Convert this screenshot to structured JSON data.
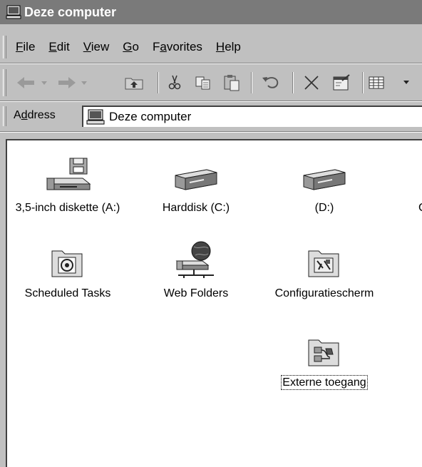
{
  "window": {
    "title": "Deze computer"
  },
  "menu": [
    {
      "pre": "",
      "key": "F",
      "post": "ile"
    },
    {
      "pre": "",
      "key": "E",
      "post": "dit"
    },
    {
      "pre": "",
      "key": "V",
      "post": "iew"
    },
    {
      "pre": "",
      "key": "G",
      "post": "o"
    },
    {
      "pre": "F",
      "key": "a",
      "post": "vorites"
    },
    {
      "pre": "",
      "key": "H",
      "post": "elp"
    }
  ],
  "toolbar": {
    "buttons": [
      "back-arrow-icon",
      "forward-arrow-icon",
      "up-folder-icon",
      "cut-icon",
      "copy-icon",
      "paste-icon",
      "undo-icon",
      "delete-icon",
      "properties-icon",
      "views-icon"
    ]
  },
  "address": {
    "pre": "A",
    "key": "d",
    "post": "dress",
    "value": "Deze computer"
  },
  "items": [
    {
      "label": "3,5-inch diskette (A:)",
      "icon": "floppy-drive-icon"
    },
    {
      "label": "Harddisk (C:)",
      "icon": "hard-drive-icon"
    },
    {
      "label": "(D:)",
      "icon": "hard-drive-icon"
    },
    {
      "label": "C",
      "icon": ""
    },
    {
      "label": "Scheduled Tasks",
      "icon": "scheduled-tasks-icon"
    },
    {
      "label": "Web Folders",
      "icon": "web-folders-icon"
    },
    {
      "label": "Configuratiescherm",
      "icon": "control-panel-icon"
    },
    {
      "label": "Externe toegang",
      "icon": "dialup-networking-icon",
      "selected": true
    }
  ]
}
